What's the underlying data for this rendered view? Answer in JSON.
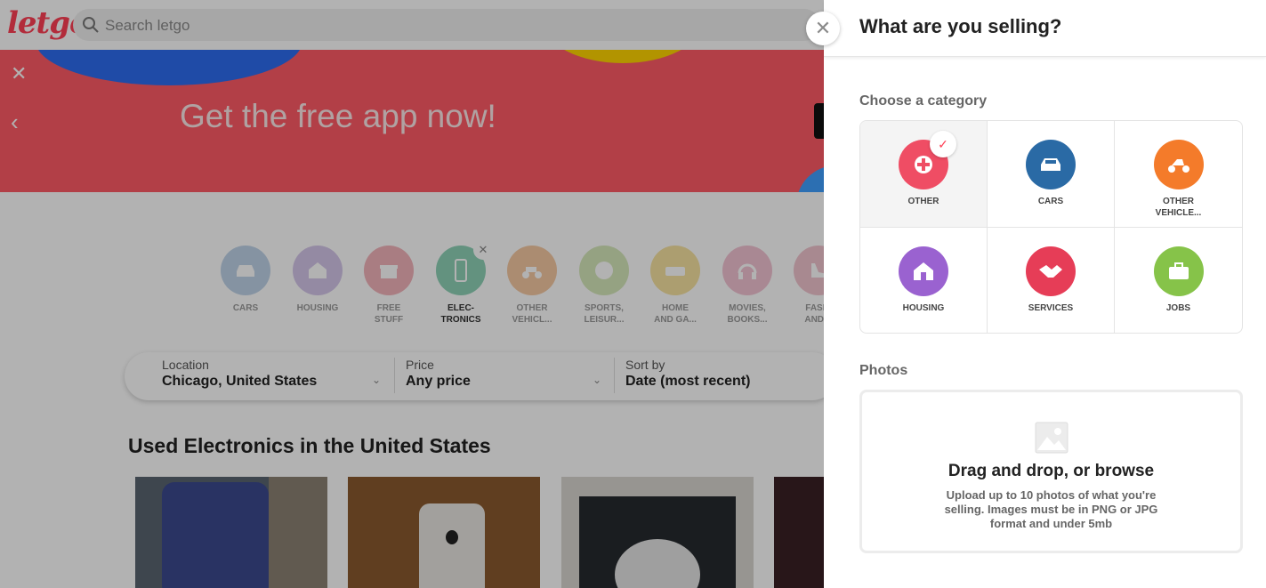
{
  "topbar": {
    "logo": "letgo",
    "search_placeholder": "Search letgo"
  },
  "banner": {
    "title": "Get the free app now!"
  },
  "categories": [
    {
      "label": "CARS",
      "color": "#bfd3e8",
      "icon": "car-icon"
    },
    {
      "label": "HOUSING",
      "color": "#d4c6ea",
      "icon": "house-icon"
    },
    {
      "label": "FREE\nSTUFF",
      "color": "#f3b3bb",
      "icon": "gift-icon"
    },
    {
      "label": "ELEC-\nTRONICS",
      "color": "#8fd1b7",
      "icon": "phone-icon",
      "selected": true
    },
    {
      "label": "OTHER\nVEHICL...",
      "color": "#f5c9a3",
      "icon": "scooter-icon"
    },
    {
      "label": "SPORTS,\nLEISUR...",
      "color": "#d6e8bb",
      "icon": "ball-icon"
    },
    {
      "label": "HOME\nAND GA...",
      "color": "#f6e2a1",
      "icon": "sofa-icon"
    },
    {
      "label": "MOVIES,\nBOOKS...",
      "color": "#f3c3d3",
      "icon": "headphones-icon"
    },
    {
      "label": "FASHI\nAND A",
      "color": "#f1c5cf",
      "icon": "shoe-icon"
    }
  ],
  "filters": {
    "location_label": "Location",
    "location_value": "Chicago, United States",
    "price_label": "Price",
    "price_value": "Any price",
    "sort_label": "Sort by",
    "sort_value": "Date (most recent)"
  },
  "listing_title": "Used Electronics in the United States",
  "modal": {
    "title": "What are you selling?",
    "choose_category": "Choose a category",
    "options": [
      {
        "label": "OTHER",
        "color": "#ef4d64",
        "icon": "plus-icon",
        "selected": true
      },
      {
        "label": "CARS",
        "color": "#2a6aa5",
        "icon": "car-icon"
      },
      {
        "label": "OTHER\nVEHICLE...",
        "color": "#f47b2a",
        "icon": "scooter-icon"
      },
      {
        "label": "HOUSING",
        "color": "#9a62d0",
        "icon": "house-icon"
      },
      {
        "label": "SERVICES",
        "color": "#e63d57",
        "icon": "handshake-icon"
      },
      {
        "label": "JOBS",
        "color": "#86c349",
        "icon": "briefcase-icon"
      }
    ],
    "photos_label": "Photos",
    "dropzone_title": "Drag and drop, or browse",
    "dropzone_sub": "Upload up to 10 photos of what you're selling. Images must be in PNG or JPG format and under 5mb"
  }
}
